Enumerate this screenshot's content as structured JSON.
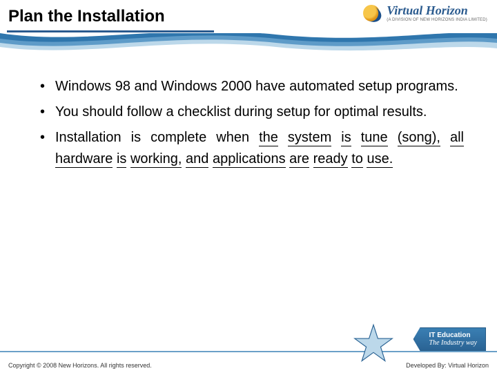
{
  "header": {
    "title": "Plan the Installation",
    "brand_name": "Virtual Horizon",
    "brand_sub": "(A DIVISION OF NEW HORIZONS INDIA LIMITED)"
  },
  "bullets": [
    "Windows 98 and Windows 2000 have automated setup programs.",
    "You should follow a checklist during setup for optimal results.",
    "Installation is complete when"
  ],
  "bullet3_underlined_words": [
    "the",
    "system",
    "is",
    "tune",
    "(song),",
    "all",
    "hardware",
    "is",
    "working,",
    "and",
    "applications",
    "are",
    "ready",
    "to",
    "use."
  ],
  "footer": {
    "tag_line1": "IT Education",
    "tag_line2": "The Industry way",
    "copyright": "Copyright © 2008 New Horizons. All rights reserved.",
    "devby": "Developed By: Virtual Horizon"
  },
  "colors": {
    "brand_blue": "#2a5a8e",
    "wave_dark": "#2f76ad",
    "wave_light": "#bcd8ea"
  }
}
